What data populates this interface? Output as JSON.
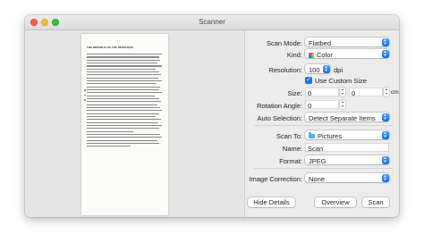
{
  "window": {
    "title": "Scanner"
  },
  "preview": {
    "document_heading": "THE REPUBLIC OF THE RESOURCE"
  },
  "settings": {
    "scan_mode": {
      "label": "Scan Mode:",
      "value": "Flatbed"
    },
    "kind": {
      "label": "Kind:",
      "value": "Color",
      "icon": "color-wheel-icon"
    },
    "resolution": {
      "label": "Resolution:",
      "value": "100",
      "unit": "dpi"
    },
    "use_custom_size": {
      "label": "Use Custom Size",
      "checked": true
    },
    "size": {
      "label": "Size:",
      "width": "0",
      "height": "0",
      "unit": "cm"
    },
    "rotation_angle": {
      "label": "Rotation Angle:",
      "value": "0"
    },
    "auto_selection": {
      "label": "Auto Selection:",
      "value": "Detect Separate Items"
    },
    "scan_to": {
      "label": "Scan To:",
      "value": "Pictures",
      "icon": "folder-icon"
    },
    "name": {
      "label": "Name:",
      "value": "Scan"
    },
    "format": {
      "label": "Format:",
      "value": "JPEG"
    },
    "image_correction": {
      "label": "Image Correction:",
      "value": "None"
    }
  },
  "buttons": {
    "hide_details": "Hide Details",
    "overview": "Overview",
    "scan": "Scan"
  },
  "colors": {
    "accent": "#1a6ff0",
    "close": "#fe5f57",
    "minimize": "#febc2e",
    "maximize": "#28c840"
  }
}
